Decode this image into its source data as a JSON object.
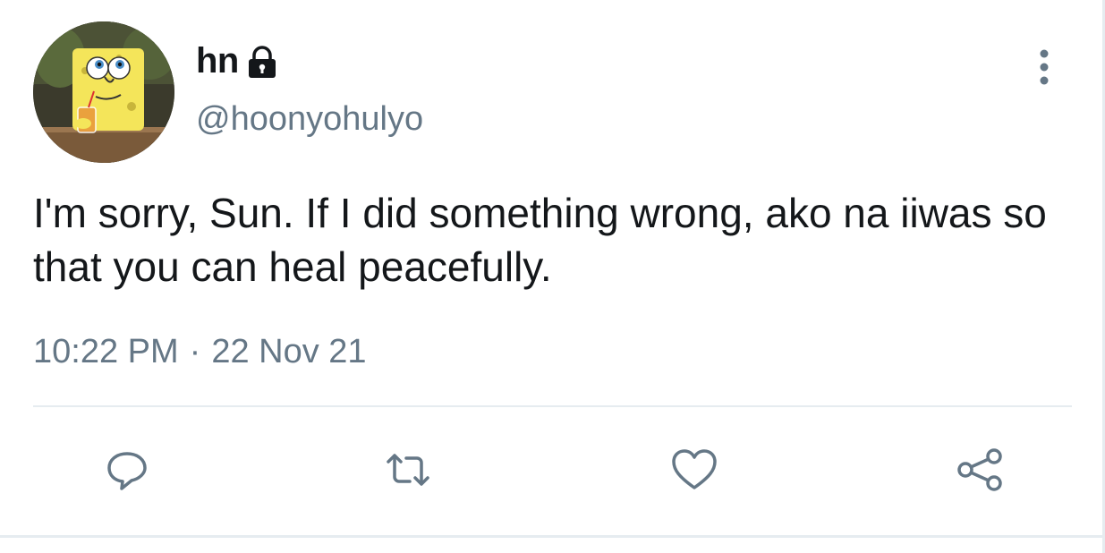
{
  "author": {
    "display_name": "hn",
    "handle": "@hoonyohulyo",
    "protected_icon": "lock-icon",
    "avatar_icon": "spongebob-avatar"
  },
  "tweet": {
    "text": "I'm sorry, Sun. If I did something wrong, ako na iiwas so that you can heal peacefully.",
    "time": "10:22 PM",
    "separator": "·",
    "date": "22 Nov 21"
  },
  "actions": [
    {
      "name": "reply",
      "icon": "reply-icon"
    },
    {
      "name": "retweet",
      "icon": "retweet-icon"
    },
    {
      "name": "like",
      "icon": "heart-icon"
    },
    {
      "name": "share",
      "icon": "share-icon"
    }
  ],
  "menu": {
    "icon": "more-vertical-icon"
  },
  "colors": {
    "text": "#14171a",
    "secondary": "#657786",
    "divider": "#e6ecf0"
  }
}
